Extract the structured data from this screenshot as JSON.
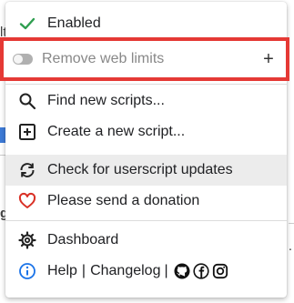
{
  "background": {
    "fragment_top": "lt",
    "fragment_mid": "g",
    "fragment_right": "."
  },
  "menu": {
    "enabled_label": "Enabled",
    "script": {
      "name": "Remove web limits",
      "enabled": false,
      "add_label": "+"
    },
    "find_label": "Find new scripts...",
    "create_label": "Create a new script...",
    "check_updates_label": "Check for userscript updates",
    "donate_label": "Please send a donation",
    "dashboard_label": "Dashboard",
    "help_label": "Help",
    "divider": "|",
    "changelog_label": "Changelog",
    "divider2": "|"
  },
  "colors": {
    "highlight_border": "#e53935",
    "check": "#2e9e4f",
    "heart": "#d93025",
    "info": "#1a73e8",
    "hover_bg": "#ececec"
  }
}
